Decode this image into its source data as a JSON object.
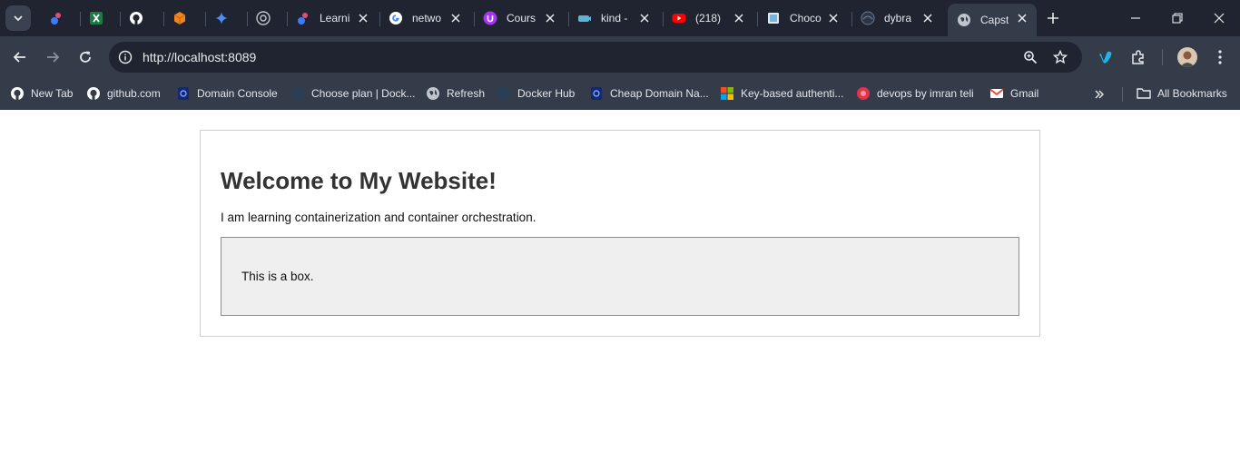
{
  "browser": {
    "tabs": [
      {
        "title": "",
        "favicon": "pink-blob-icon",
        "color": "#3d7cf5"
      },
      {
        "title": "",
        "favicon": "excel-icon",
        "color": "#1d7a43"
      },
      {
        "title": "",
        "favicon": "github-icon",
        "color": "#ffffff"
      },
      {
        "title": "",
        "favicon": "orange-cube-icon",
        "color": "#f0851f"
      },
      {
        "title": "",
        "favicon": "gemini-sparkle-icon",
        "color": "#4a8ef7"
      },
      {
        "title": "",
        "favicon": "chatgpt-icon",
        "color": "#c0c4cc"
      },
      {
        "title": "Learni",
        "favicon": "pink-blob-icon",
        "color": "#3d7cf5"
      },
      {
        "title": "netwo",
        "favicon": "google-icon",
        "color": "#4285f4"
      },
      {
        "title": "Cours",
        "favicon": "udemy-icon",
        "color": "#a435f0"
      },
      {
        "title": "kind -",
        "favicon": "kind-icon",
        "color": "#5fb3d9"
      },
      {
        "title": "(218) ",
        "favicon": "youtube-icon",
        "color": "#ff0000"
      },
      {
        "title": "Choco",
        "favicon": "chocolatey-icon",
        "color": "#7fb0d8"
      },
      {
        "title": "dybra",
        "favicon": "globe-dark-icon",
        "color": "#6d7890"
      },
      {
        "title": "Capst",
        "favicon": "globe-icon",
        "color": "#c0c4cc",
        "active": true
      }
    ],
    "address_bar": {
      "url": "http://localhost:8089"
    },
    "bookmarks": [
      {
        "label": "New Tab",
        "icon": "github-icon"
      },
      {
        "label": "github.com",
        "icon": "github-icon"
      },
      {
        "label": "Domain Console",
        "icon": "godaddy-icon"
      },
      {
        "label": "Choose plan | Dock...",
        "icon": "docker-icon"
      },
      {
        "label": "Refresh",
        "icon": "globe-icon"
      },
      {
        "label": "Docker Hub",
        "icon": "docker-icon"
      },
      {
        "label": "Cheap Domain Na...",
        "icon": "godaddy-icon"
      },
      {
        "label": "Key-based authenti...",
        "icon": "microsoft-icon"
      },
      {
        "label": "devops by imran teli",
        "icon": "devops-icon"
      },
      {
        "label": "Gmail",
        "icon": "gmail-icon"
      }
    ],
    "all_bookmarks_label": "All Bookmarks"
  },
  "page": {
    "heading": "Welcome to My Website!",
    "paragraph": "I am learning containerization and container orchestration.",
    "box_text": "This is a box."
  }
}
